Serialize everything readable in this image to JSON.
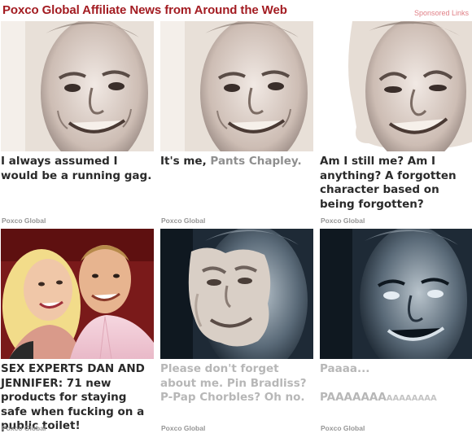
{
  "header": {
    "title": "Poxco Global Affiliate News from Around the Web",
    "sponsored_label": "Sponsored Links"
  },
  "cards": [
    {
      "caption": "I always assumed I would be a running gag.",
      "source": "Poxco Global"
    },
    {
      "caption_prefix": "It's me, ",
      "caption_highlight": "Pants Chapley.",
      "source": "Poxco Global"
    },
    {
      "caption": "Am I still me? Am I anything? A forgotten character based on being forgotten?",
      "source": "Poxco Global"
    },
    {
      "caption": "SEX EXPERTS DAN AND JENNIFER: 71 new products for staying safe when fucking on a public toilet!",
      "source": "Poxco Global"
    },
    {
      "caption": "Please don't forget about me. Pin Bradliss? P-Pap Chorbles? Oh no.",
      "source": "Poxco Global"
    },
    {
      "caption_line1": "Paaaa...",
      "caption_big": "PAAAAAAA",
      "caption_small": "AAAAAAAA",
      "source": "Poxco Global"
    }
  ]
}
